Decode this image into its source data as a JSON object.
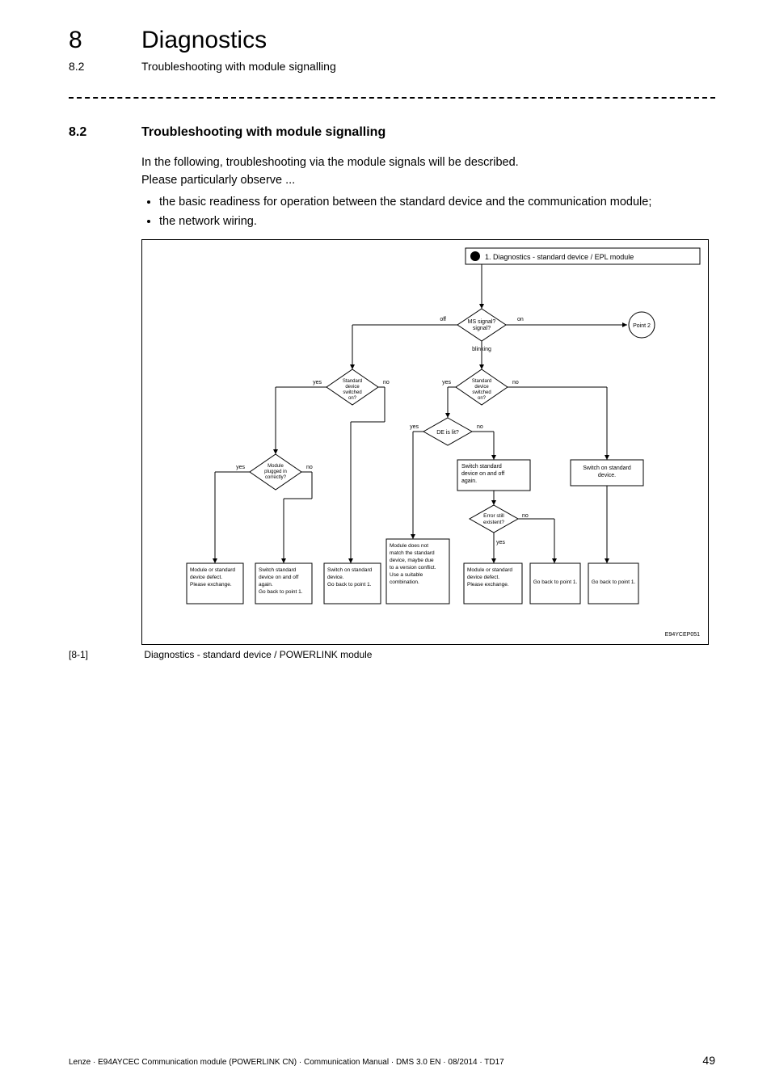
{
  "header": {
    "chapter_num": "8",
    "chapter_title": "Diagnostics",
    "section_num": "8.2",
    "section_title": "Troubleshooting with module signalling"
  },
  "section": {
    "num": "8.2",
    "title": "Troubleshooting with module signalling",
    "intro1": "In the following, troubleshooting via the module signals will be described.",
    "intro2": "Please particularly observe ...",
    "bullet1": "the basic readiness for operation between the standard device and the communication module;",
    "bullet2": "the network wiring."
  },
  "flowchart": {
    "title": "1. Diagnostics - standard device / EPL module",
    "image_id": "E94YCEP051",
    "ms_signal": "MS signal?",
    "ms_off": "off",
    "ms_on": "on",
    "ms_blinking": "blinking",
    "point2": "Point 2",
    "std_on_l": "Standard device switched on?",
    "std_on_r": "Standard device switched on?",
    "de_lit": "DE is lit?",
    "module_plugged": "Module plugged in correctly?",
    "switch_on_off_again_box": "Switch standard device on and off again.",
    "switch_on_std": "Switch on standard device.",
    "error_still": "Error still existent?",
    "r1": "Module or standard device defect. Please exchange.",
    "r2": "Switch standard device on and off again. Go back to point 1.",
    "r3": "Switch on standard device. Go back to point 1.",
    "r4": "Module does not match the standard device, maybe due to a version conflict. Use a suitable combination.",
    "r5": "Module or standard device defect. Please exchange.",
    "r6": "Go back to point 1.",
    "r7": "Go back to point 1.",
    "yes": "yes",
    "no": "no"
  },
  "figure": {
    "num": "[8-1]",
    "caption": "Diagnostics - standard device / POWERLINK module"
  },
  "footer": {
    "line": "Lenze · E94AYCEC Communication module (POWERLINK CN) · Communication Manual · DMS 3.0 EN · 08/2014 · TD17",
    "page": "49"
  }
}
